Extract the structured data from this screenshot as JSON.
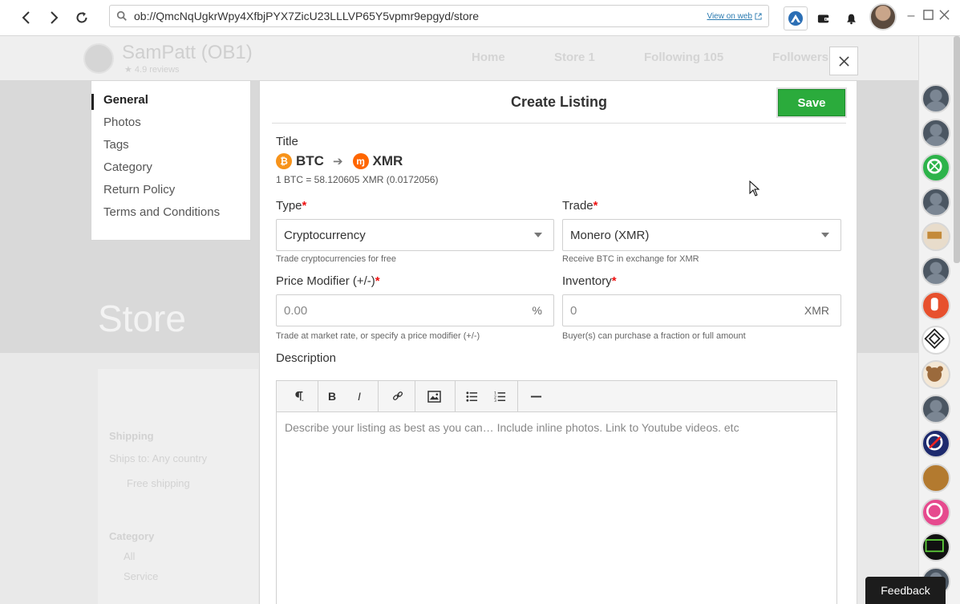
{
  "browser": {
    "url": "ob://QmcNqUgkrWpy4XfbjPYX7ZicU23LLLVP65Y5vpmr9epgyd/store",
    "view_on_web": "View on web"
  },
  "background_page": {
    "store_name": "SamPatt (OB1)",
    "store_sub": "★ 4.9 reviews",
    "tabs": [
      "Home",
      "Store 1",
      "Following 105",
      "Followers"
    ],
    "hero_text": "Store",
    "shipping_label": "Shipping",
    "ships_to": "Ships to:  Any country",
    "free_shipping": "Free shipping",
    "category_label": "Category",
    "cat_all": "All",
    "cat_service": "Service"
  },
  "sidenav": {
    "items": [
      "General",
      "Photos",
      "Tags",
      "Category",
      "Return Policy",
      "Terms and Conditions"
    ]
  },
  "form": {
    "heading": "Create Listing",
    "save_label": "Save",
    "title_label": "Title",
    "title_from": "BTC",
    "title_to": "XMR",
    "rate": "1 BTC = 58.120605 XMR (0.0172056)",
    "type_label": "Type",
    "type_value": "Cryptocurrency",
    "type_help": "Trade cryptocurrencies for free",
    "trade_label": "Trade",
    "trade_value": "Monero (XMR)",
    "trade_help": "Receive BTC in exchange for XMR",
    "price_label": "Price Modifier (+/-)",
    "price_placeholder": "0.00",
    "price_unit": "%",
    "price_help": "Trade at market rate, or specify a price modifier (+/-)",
    "inventory_label": "Inventory",
    "inventory_placeholder": "0",
    "inventory_unit": "XMR",
    "inventory_help": "Buyer(s) can purchase a fraction or full amount",
    "description_label": "Description",
    "description_placeholder": "Describe your listing as best as you can… Include inline photos. Link to Youtube videos. etc",
    "required_mark": "*"
  },
  "toolbar": {
    "bold": "B",
    "italic": "I"
  },
  "feedback_label": "Feedback",
  "colors": {
    "save": "#2bab3c",
    "required": "#ee1111",
    "btc": "#f7931a",
    "xmr": "#ff6600"
  }
}
